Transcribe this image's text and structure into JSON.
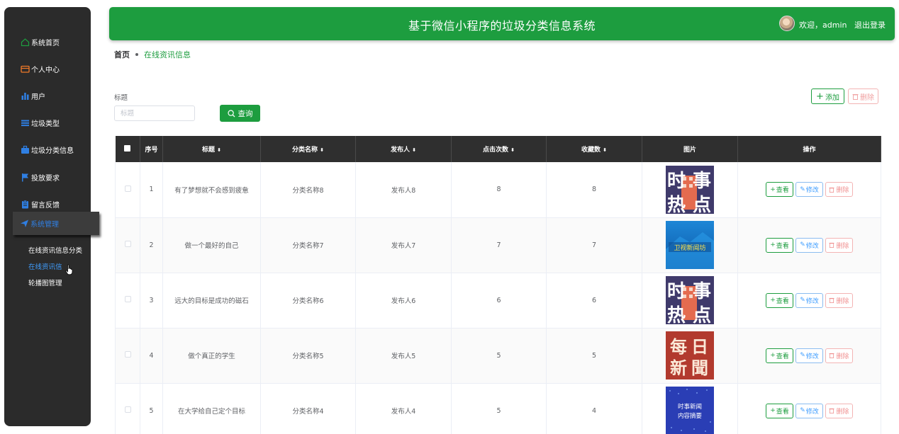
{
  "header": {
    "title": "基于微信小程序的垃圾分类信息系统",
    "welcome": "欢迎，admin",
    "logout": "退出登录"
  },
  "sidebar": {
    "items": [
      {
        "label": "系统首页",
        "icon": "home-icon",
        "color": "#1d9d3f"
      },
      {
        "label": "个人中心",
        "icon": "wallet-icon",
        "color": "#f07a28"
      },
      {
        "label": "用户",
        "icon": "bar-chart-icon",
        "color": "#2f7fe3"
      },
      {
        "label": "垃圾类型",
        "icon": "list-icon",
        "color": "#2f7fe3"
      },
      {
        "label": "垃圾分类信息",
        "icon": "briefcase-icon",
        "color": "#2f7fe3"
      },
      {
        "label": "投放要求",
        "icon": "flag-icon",
        "color": "#2f7fe3"
      },
      {
        "label": "留言反馈",
        "icon": "clipboard-icon",
        "color": "#2f7fe3"
      },
      {
        "label": "系统管理",
        "icon": "send-icon",
        "color": "#2f7fe3"
      }
    ],
    "sub_items": [
      {
        "label": "在线资讯信息分类"
      },
      {
        "label": "在线资讯信"
      },
      {
        "label": "轮播图管理"
      }
    ]
  },
  "breadcrumb": {
    "home": "首页",
    "current": "在线资讯信息"
  },
  "search": {
    "label": "标题",
    "placeholder": "标题",
    "button": "查询"
  },
  "toolbar": {
    "add": "添加",
    "delete": "删除"
  },
  "table": {
    "columns": [
      "序号",
      "标题",
      "分类名称",
      "发布人",
      "点击次数",
      "收藏数",
      "图片",
      "操作"
    ],
    "rows": [
      {
        "index": "1",
        "title": "有了梦想就不会感到疲惫",
        "category": "分类名称8",
        "publisher": "发布人8",
        "clicks": "8",
        "favorites": "8",
        "image": "news-hot-topic",
        "img_text": [
          "时",
          "事",
          "热",
          "点"
        ]
      },
      {
        "index": "2",
        "title": "做一个最好的自己",
        "category": "分类名称7",
        "publisher": "发布人7",
        "clicks": "7",
        "favorites": "7",
        "image": "news-broadcast-blue",
        "img_text": [
          "卫视新闻坊"
        ]
      },
      {
        "index": "3",
        "title": "远大的目标是成功的磁石",
        "category": "分类名称6",
        "publisher": "发布人6",
        "clicks": "6",
        "favorites": "6",
        "image": "news-hot-topic",
        "img_text": [
          "时",
          "事",
          "热",
          "点"
        ]
      },
      {
        "index": "4",
        "title": "做个真正的学生",
        "category": "分类名称5",
        "publisher": "发布人5",
        "clicks": "5",
        "favorites": "5",
        "image": "daily-news-red",
        "img_text": [
          "每",
          "日",
          "新",
          "聞"
        ]
      },
      {
        "index": "5",
        "title": "在大学给自己定个目标",
        "category": "分类名称4",
        "publisher": "发布人4",
        "clicks": "5",
        "favorites": "4",
        "image": "news-summary-blue",
        "img_text": [
          "时事新闻",
          "内容摘要"
        ]
      }
    ],
    "actions": {
      "view": "查看",
      "edit": "修改",
      "delete": "删除"
    }
  },
  "colors": {
    "primary": "#1d9d3f",
    "sidebar_bg": "#2b2b2b",
    "table_header_bg": "#2f2f2f",
    "link_blue": "#409eff",
    "danger": "#f09090"
  }
}
